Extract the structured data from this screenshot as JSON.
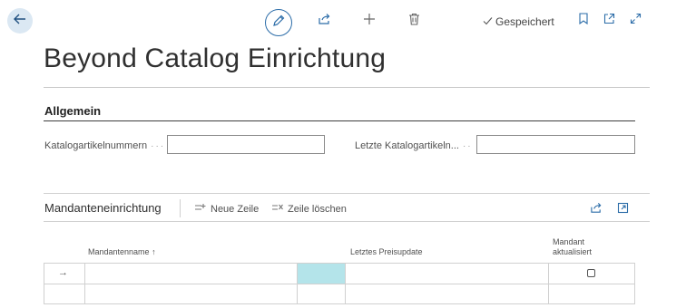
{
  "header": {
    "back_icon": "arrow-left-icon",
    "tools": [
      "edit-icon",
      "share-icon",
      "plus-icon",
      "trash-icon"
    ],
    "status": "Gespeichert",
    "right_icons": [
      "bookmark-icon",
      "open-in-new-icon",
      "expand-icon"
    ]
  },
  "page": {
    "title": "Beyond Catalog Einrichtung"
  },
  "general": {
    "title": "Allgemein",
    "fields": [
      {
        "label": "Katalogartikelnummern",
        "value": ""
      },
      {
        "label": "Letzte Katalogartikeln...",
        "value": ""
      }
    ]
  },
  "part": {
    "title": "Mandanteneinrichtung",
    "actions": {
      "new_line": "Neue Zeile",
      "delete_line": "Zeile löschen"
    },
    "columns": {
      "company_name": "Mandantenname",
      "sort_indicator": "↑",
      "last_price_update": "Letztes Preisupdate",
      "company_updated_line1": "Mandant",
      "company_updated_line2": "aktualisiert"
    },
    "rows": [
      {
        "marker": "→",
        "company_name": "",
        "last_price_update": "",
        "company_updated": false
      },
      {
        "marker": "",
        "company_name": "",
        "last_price_update": "",
        "company_updated": null
      }
    ]
  },
  "colors": {
    "accent": "#2b6ca8",
    "selected_cell": "#b4e4ea",
    "back_button_bg": "#dbe8f3"
  }
}
